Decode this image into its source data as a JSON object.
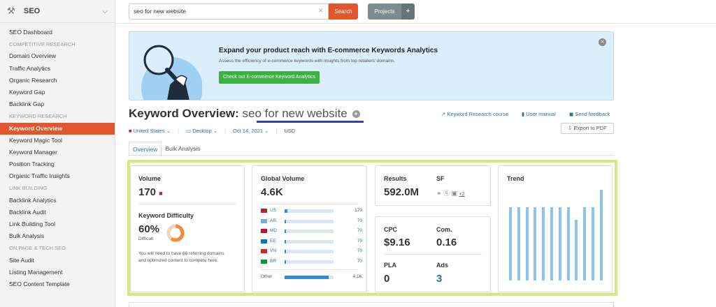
{
  "sidebar": {
    "title": "SEO",
    "items": [
      {
        "type": "item",
        "label": "SEO Dashboard"
      },
      {
        "type": "section",
        "label": "COMPETITIVE RESEARCH"
      },
      {
        "type": "item",
        "label": "Domain Overview"
      },
      {
        "type": "item",
        "label": "Traffic Analytics"
      },
      {
        "type": "item",
        "label": "Organic Research"
      },
      {
        "type": "item",
        "label": "Keyword Gap"
      },
      {
        "type": "item",
        "label": "Backlink Gap"
      },
      {
        "type": "section",
        "label": "KEYWORD RESEARCH"
      },
      {
        "type": "item",
        "label": "Keyword Overview",
        "active": true
      },
      {
        "type": "item",
        "label": "Keyword Magic Tool"
      },
      {
        "type": "item",
        "label": "Keyword Manager"
      },
      {
        "type": "item",
        "label": "Position Tracking"
      },
      {
        "type": "item",
        "label": "Organic Traffic Insights"
      },
      {
        "type": "section",
        "label": "LINK BUILDING"
      },
      {
        "type": "item",
        "label": "Backlink Analytics"
      },
      {
        "type": "item",
        "label": "Backlink Audit"
      },
      {
        "type": "item",
        "label": "Link Building Tool"
      },
      {
        "type": "item",
        "label": "Bulk Analysis"
      },
      {
        "type": "section",
        "label": "ON PAGE & TECH SEO"
      },
      {
        "type": "item",
        "label": "Site Audit"
      },
      {
        "type": "item",
        "label": "Listing Management"
      },
      {
        "type": "item",
        "label": "SEO Content Template"
      }
    ]
  },
  "topbar": {
    "search_value": "seo for new website",
    "search_button": "Search",
    "projects_button": "Projects",
    "plus": "+"
  },
  "banner": {
    "title": "Expand your product reach with E-commerce Keywords Analytics",
    "text": "Assess the efficiency of e-commerce keywords with insights from top retailers' domains.",
    "button": "Check out E-commerce Keyword Analytics"
  },
  "header": {
    "title_prefix": "Keyword Overview:",
    "keyword": "seo for new website",
    "links": {
      "course": "Keyword Research course",
      "manual": "User manual",
      "feedback": "Send feedback"
    },
    "export": "Export to PDF",
    "filters": {
      "country": "United States",
      "device": "Desktop",
      "date": "Oct 14, 2021",
      "currency": "USD"
    },
    "tabs": [
      "Overview",
      "Bulk Analysis"
    ]
  },
  "volume": {
    "label": "Volume",
    "value": "170",
    "kd_label": "Keyword Difficulty",
    "kd_value": "60%",
    "kd_percent": 60,
    "kd_text": "Difficult",
    "kd_desc": "You will need to have 66 referring domains and optimized content to compete here."
  },
  "global": {
    "label": "Global Volume",
    "value": "4.6K",
    "rows": [
      {
        "code": "US",
        "value": "170",
        "fill": 0.05,
        "flag": "#b22234"
      },
      {
        "code": "AR",
        "value": "70",
        "fill": 0.03,
        "flag": "#74acdf"
      },
      {
        "code": "MD",
        "value": "70",
        "fill": 0.03,
        "flag": "#cc092f"
      },
      {
        "code": "EE",
        "value": "70",
        "fill": 0.03,
        "flag": "#0072ce"
      },
      {
        "code": "VN",
        "value": "70",
        "fill": 0.03,
        "flag": "#da251d"
      },
      {
        "code": "BR",
        "value": "70",
        "fill": 0.03,
        "flag": "#009c3b"
      }
    ],
    "other_label": "Other",
    "other_value": "4.1K",
    "other_fill": 0.9
  },
  "results": {
    "results_label": "Results",
    "results_value": "592.0M",
    "sf_label": "SF",
    "sf_more": "+2"
  },
  "cpc": {
    "cpc_label": "CPC",
    "cpc_value": "$9.16",
    "com_label": "Com.",
    "com_value": "0.16",
    "pla_label": "PLA",
    "pla_value": "0",
    "ads_label": "Ads",
    "ads_value": "3"
  },
  "trend": {
    "label": "Trend",
    "values": [
      0.81,
      0.81,
      0.81,
      0.81,
      0.81,
      0.81,
      0.81,
      0.81,
      0.67,
      0.81,
      0.81,
      1.0
    ],
    "color": "#8bc4ee"
  },
  "colors": {
    "accent": "#e2562e",
    "link": "#2872b0",
    "highlight": "#dbe77e"
  }
}
